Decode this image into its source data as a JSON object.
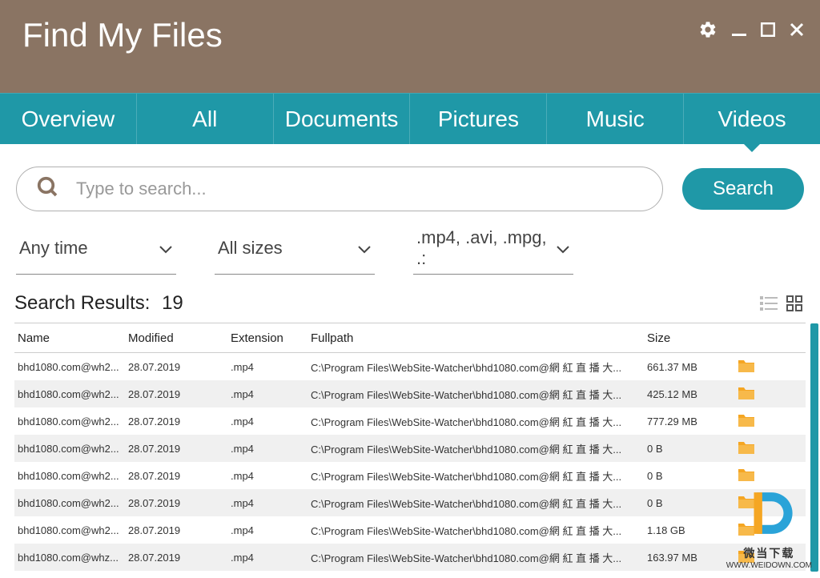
{
  "app": {
    "title": "Find My Files"
  },
  "tabs": [
    {
      "label": "Overview"
    },
    {
      "label": "All"
    },
    {
      "label": "Documents"
    },
    {
      "label": "Pictures"
    },
    {
      "label": "Music"
    },
    {
      "label": "Videos",
      "active": true
    }
  ],
  "search": {
    "placeholder": "Type to search...",
    "button": "Search"
  },
  "filters": {
    "time": "Any time",
    "size": "All sizes",
    "ext": ".mp4, .avi, .mpg, .:"
  },
  "results": {
    "label": "Search Results:",
    "count": "19",
    "columns": {
      "name": "Name",
      "modified": "Modified",
      "ext": "Extension",
      "path": "Fullpath",
      "size": "Size"
    },
    "rows": [
      {
        "name": "bhd1080.com@wh2...",
        "modified": "28.07.2019",
        "ext": ".mp4",
        "path": "C:\\Program Files\\WebSite-Watcher\\bhd1080.com@網 紅 直 播 大...",
        "size": "661.37 MB"
      },
      {
        "name": "bhd1080.com@wh2...",
        "modified": "28.07.2019",
        "ext": ".mp4",
        "path": "C:\\Program Files\\WebSite-Watcher\\bhd1080.com@網 紅 直 播 大...",
        "size": "425.12 MB"
      },
      {
        "name": "bhd1080.com@wh2...",
        "modified": "28.07.2019",
        "ext": ".mp4",
        "path": "C:\\Program Files\\WebSite-Watcher\\bhd1080.com@網 紅 直 播 大...",
        "size": "777.29 MB"
      },
      {
        "name": "bhd1080.com@wh2...",
        "modified": "28.07.2019",
        "ext": ".mp4",
        "path": "C:\\Program Files\\WebSite-Watcher\\bhd1080.com@網 紅 直 播 大...",
        "size": "0 B"
      },
      {
        "name": "bhd1080.com@wh2...",
        "modified": "28.07.2019",
        "ext": ".mp4",
        "path": "C:\\Program Files\\WebSite-Watcher\\bhd1080.com@網 紅 直 播 大...",
        "size": "0 B"
      },
      {
        "name": "bhd1080.com@wh2...",
        "modified": "28.07.2019",
        "ext": ".mp4",
        "path": "C:\\Program Files\\WebSite-Watcher\\bhd1080.com@網 紅 直 播 大...",
        "size": "0 B"
      },
      {
        "name": "bhd1080.com@wh2...",
        "modified": "28.07.2019",
        "ext": ".mp4",
        "path": "C:\\Program Files\\WebSite-Watcher\\bhd1080.com@網 紅 直 播 大...",
        "size": "1.18 GB"
      },
      {
        "name": "bhd1080.com@whz...",
        "modified": "28.07.2019",
        "ext": ".mp4",
        "path": "C:\\Program Files\\WebSite-Watcher\\bhd1080.com@網 紅 直 播 大...",
        "size": "163.97 MB"
      }
    ]
  },
  "watermark": {
    "line1": "微当下载",
    "line2": "WWW.WEIDOWN.COM"
  }
}
